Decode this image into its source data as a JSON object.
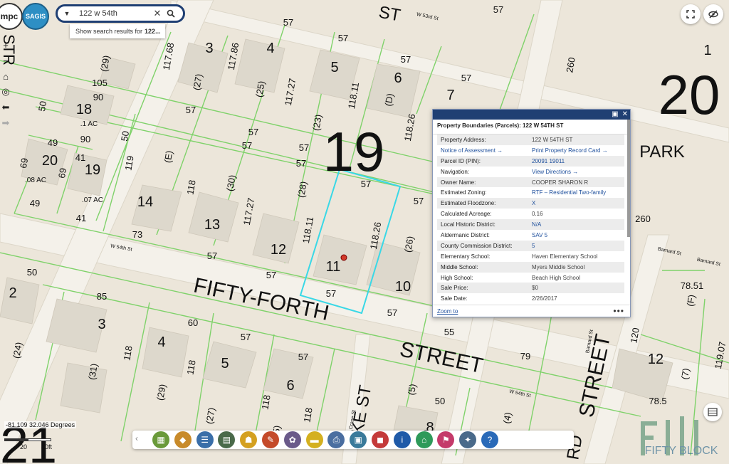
{
  "search": {
    "value": "122 w 54th",
    "suggestion_prefix": "Show search results for",
    "suggestion_query": "122..."
  },
  "logos": {
    "mpc": "mpc",
    "sagis": "SAGIS"
  },
  "map": {
    "accent_color": "#39d8e6",
    "parcel_line_color": "#7fd26a",
    "big_block_numbers": [
      "19",
      "20",
      "1",
      "21"
    ],
    "street_labels": [
      "FIFTY-FORTH",
      "STREET",
      "STREET",
      "PARK",
      "ST",
      "STR",
      "AKE ST",
      "RD"
    ],
    "small_street_labels": [
      "W 53rd St",
      "W 54th St",
      "W 54th St",
      "Barnard St",
      "Barnard St",
      "Crane St",
      "Barnard St"
    ],
    "lot_numbers": [
      "3",
      "4",
      "5",
      "6",
      "7",
      "18",
      "20",
      "19",
      "14",
      "13",
      "12",
      "11",
      "10",
      "2",
      "3",
      "4",
      "5",
      "6",
      "8",
      "12"
    ],
    "acreage_labels": [
      ".1 AC",
      ".08 AC",
      ".07 AC"
    ],
    "dimension_labels": [
      "57",
      "57",
      "57",
      "57",
      "57",
      "57",
      "57",
      "57",
      "57",
      "57",
      "57",
      "57",
      "57",
      "57",
      "57",
      "57",
      "57",
      "57",
      "105",
      "90",
      "90",
      "49",
      "41",
      "41",
      "49",
      "50",
      "50",
      "50",
      "69",
      "69",
      "119",
      "118",
      "118",
      "118",
      "118",
      "118",
      "117.68",
      "117.86",
      "117.27",
      "117.27",
      "118.11",
      "118.11",
      "118.26",
      "118.26",
      "260",
      "260",
      "73",
      "85",
      "60",
      "55",
      "79",
      "50",
      "78.51",
      "78.5",
      "120",
      "119.07",
      "(29)",
      "(27)",
      "(25)",
      "(23)",
      "(D)",
      "(E)",
      "(30)",
      "(28)",
      "(26)",
      "(24)",
      "(31)",
      "(29)",
      "(27)",
      "(25)",
      "(F)",
      "(7)",
      "(5)",
      "(3)",
      "(4)",
      "(2)"
    ]
  },
  "popup": {
    "title": "Property Boundaries (Parcels): 122 W 54TH ST",
    "rows": [
      {
        "label": "Property Address:",
        "value": "122 W 54TH ST"
      },
      {
        "label": "Notice of Assessment →",
        "value": "Print Property Record Card →"
      },
      {
        "label": "Parcel ID (PIN):",
        "value": "20091 19011"
      },
      {
        "label": "Navigation:",
        "value": "View Directions →"
      },
      {
        "label": "Owner Name:",
        "value": "COOPER SHARON R"
      },
      {
        "label": "Estimated Zoning:",
        "value": "RTF – Residential Two-family"
      },
      {
        "label": "Estimated Floodzone:",
        "value": "X"
      },
      {
        "label": "Calculated Acreage:",
        "value": "0.16"
      },
      {
        "label": "Local Historic District:",
        "value": "N/A"
      },
      {
        "label": "Aldermanic District:",
        "value": "SAV 5"
      },
      {
        "label": "County Commission District:",
        "value": "5"
      },
      {
        "label": "Elementary School:",
        "value": "Haven Elementary School"
      },
      {
        "label": "Middle School:",
        "value": "Myers Middle School"
      },
      {
        "label": "High School:",
        "value": "Beach High School"
      },
      {
        "label": "Sale Price:",
        "value": "$0"
      },
      {
        "label": "Sale Date:",
        "value": "2/26/2017"
      }
    ],
    "zoom_to": "Zoom to",
    "more": "•••"
  },
  "status": {
    "coordinates": "-81.109 32.046 Degrees",
    "scale_labels": [
      "20",
      "40ft"
    ]
  },
  "toolbar": {
    "tools": [
      {
        "name": "basemap-tool",
        "color": "#6a9a3a"
      },
      {
        "name": "layer-list-tool",
        "color": "#c88a2a"
      },
      {
        "name": "legend-tool",
        "color": "#3a6ea8"
      },
      {
        "name": "gallery-tool",
        "color": "#4a6a4a"
      },
      {
        "name": "street-view-tool",
        "color": "#d4a020"
      },
      {
        "name": "measure-tool",
        "color": "#c44a2a"
      },
      {
        "name": "draw-tool",
        "color": "#6a5a8a"
      },
      {
        "name": "edit-tool",
        "color": "#d4b020"
      },
      {
        "name": "print-tool",
        "color": "#4a6ea0"
      },
      {
        "name": "report-tool",
        "color": "#3a7a9a"
      },
      {
        "name": "bookmark-tool",
        "color": "#c43a3a"
      },
      {
        "name": "info-tool",
        "color": "#1f5aa8"
      },
      {
        "name": "home-tool",
        "color": "#2e9a5a"
      },
      {
        "name": "locate-tool",
        "color": "#c43a6a"
      },
      {
        "name": "share-tool",
        "color": "#4a6a8a"
      },
      {
        "name": "help-tool",
        "color": "#2a6ab8"
      }
    ]
  },
  "watermark": {
    "text": "FIFTY BLOCK"
  }
}
